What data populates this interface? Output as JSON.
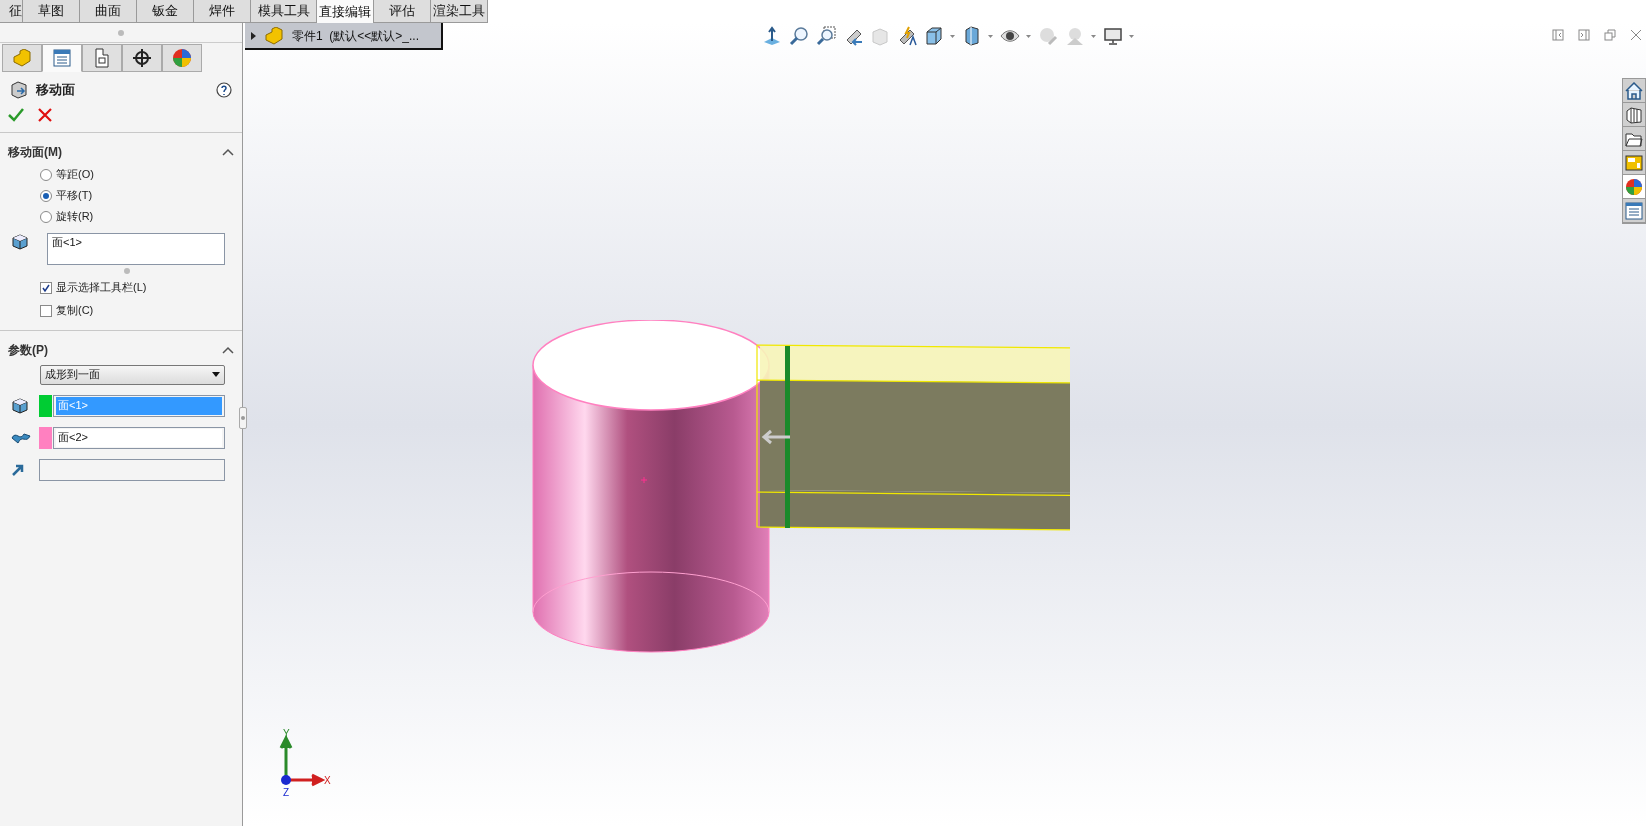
{
  "tabs": [
    {
      "label": "征",
      "selected": false
    },
    {
      "label": "草图",
      "selected": false
    },
    {
      "label": "曲面",
      "selected": false
    },
    {
      "label": "钣金",
      "selected": false
    },
    {
      "label": "焊件",
      "selected": false
    },
    {
      "label": "模具工具",
      "selected": false
    },
    {
      "label": "直接编辑",
      "selected": true
    },
    {
      "label": "评估",
      "selected": false
    },
    {
      "label": "渲染工具",
      "selected": false
    }
  ],
  "tree": {
    "label": "零件1  (默认<<默认>_..."
  },
  "panel": {
    "tabs": [
      {
        "kind": "feature",
        "selected": false
      },
      {
        "kind": "property",
        "selected": true
      },
      {
        "kind": "config",
        "selected": false
      },
      {
        "kind": "target",
        "selected": false
      },
      {
        "kind": "appearance",
        "selected": false
      }
    ],
    "title": "移动面",
    "sections": [
      {
        "title": "移动面(M)",
        "expanded": true,
        "options": [
          {
            "label": "等距(O)",
            "selected": false
          },
          {
            "label": "平移(T)",
            "selected": true
          },
          {
            "label": "旋转(R)",
            "selected": false
          }
        ],
        "faces": "面<1>",
        "checkboxes": [
          {
            "label": "显示选择工具栏(L)",
            "checked": true
          },
          {
            "label": "复制(C)",
            "checked": false
          }
        ]
      },
      {
        "title": "参数(P)",
        "expanded": true,
        "dropdown": "成形到一面",
        "fields": [
          {
            "kind": "face",
            "color": "#00cc33",
            "value": "面<1>",
            "selected": true
          },
          {
            "kind": "surface",
            "color": "#ff80c0",
            "value": "面<2>",
            "selected": false
          },
          {
            "kind": "direction"
          }
        ]
      }
    ]
  },
  "triad": {
    "y": "Y",
    "x": "X",
    "z": "Z"
  }
}
